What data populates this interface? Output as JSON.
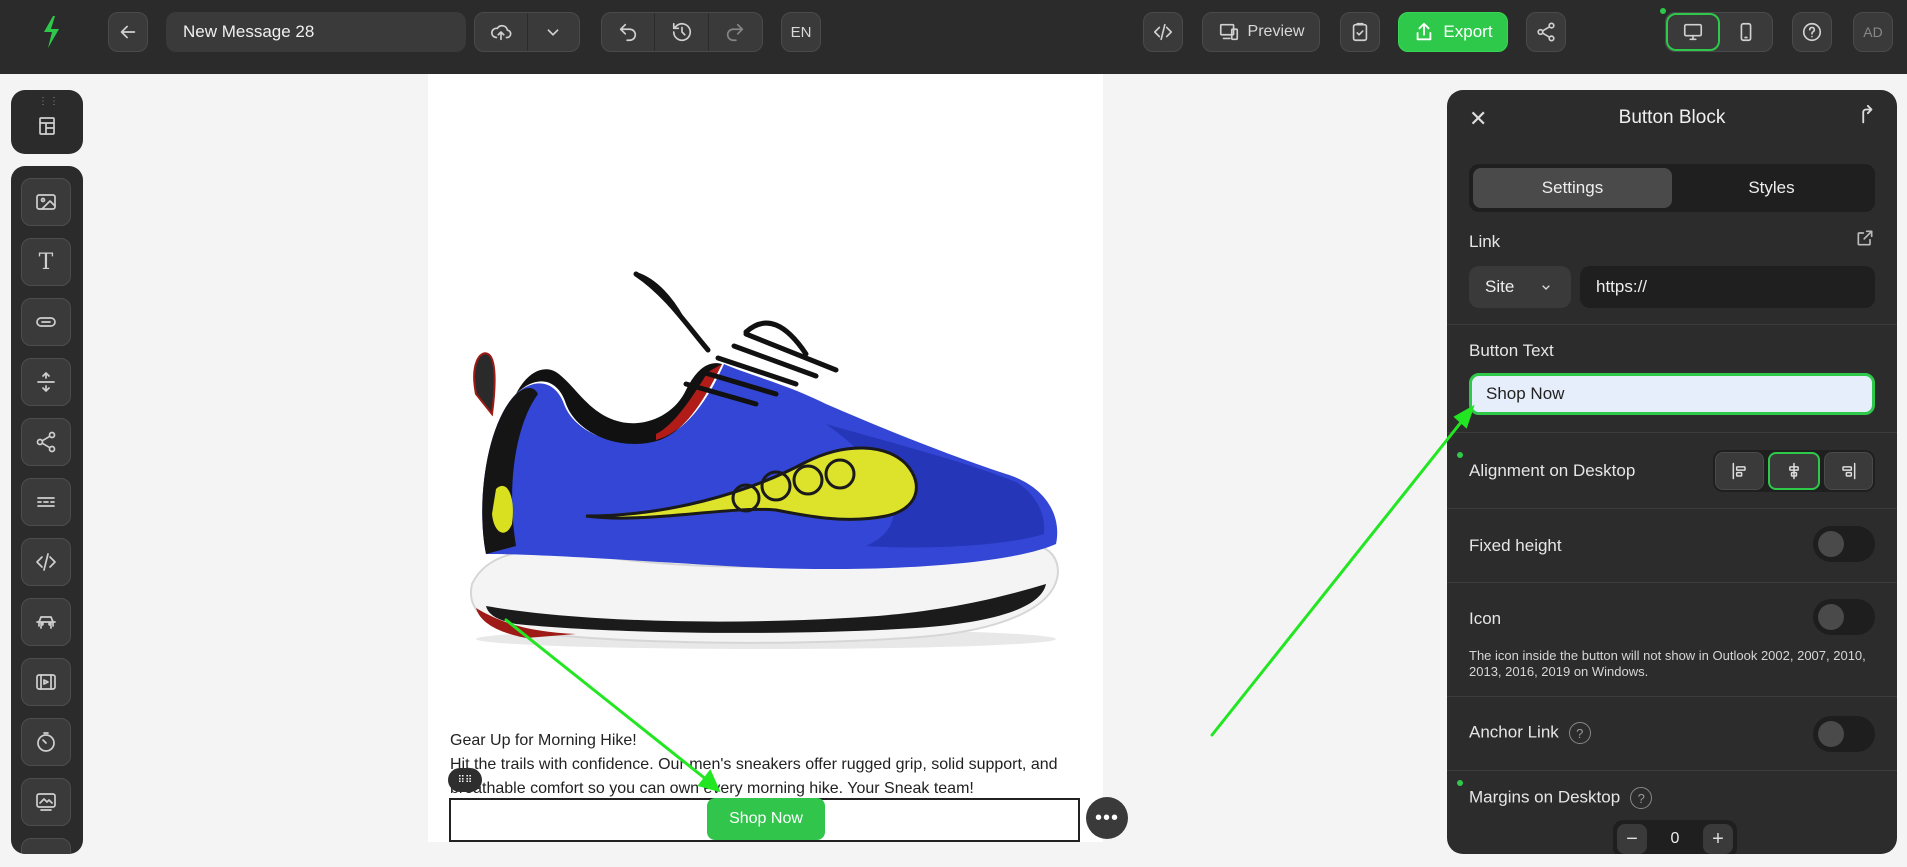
{
  "app": {
    "logo_icon": "lightning-s-logo",
    "message_title": "New Message 28",
    "language": "EN",
    "preview_label": "Preview",
    "export_label": "Export",
    "avatar_initials": "AD",
    "accent_color": "#2ec94a"
  },
  "email": {
    "headline": "Gear Up for Morning Hike!",
    "body": "Hit the trails with confidence. Our men's sneakers offer rugged grip, solid support, and breathable comfort so you can own every morning hike. Your Sneak team!",
    "button_label": "Shop Now",
    "image_icon": "blue-running-shoe-image"
  },
  "panel": {
    "title": "Button Block",
    "tabs": [
      "Settings",
      "Styles"
    ],
    "active_tab": "Settings",
    "link_label": "Link",
    "link_type": "Site",
    "link_url": "https://",
    "button_text_label": "Button Text",
    "button_text_value": "Shop Now",
    "alignment_label": "Alignment on Desktop",
    "alignment_selected": "center",
    "fixed_height_label": "Fixed height",
    "fixed_height_on": false,
    "icon_label": "Icon",
    "icon_on": false,
    "icon_note": "The icon inside the button will not show in Outlook 2002, 2007, 2010, 2013, 2016, 2019 on Windows.",
    "anchor_label": "Anchor Link",
    "anchor_on": false,
    "margins_label": "Margins on Desktop",
    "margin_value": "0"
  }
}
